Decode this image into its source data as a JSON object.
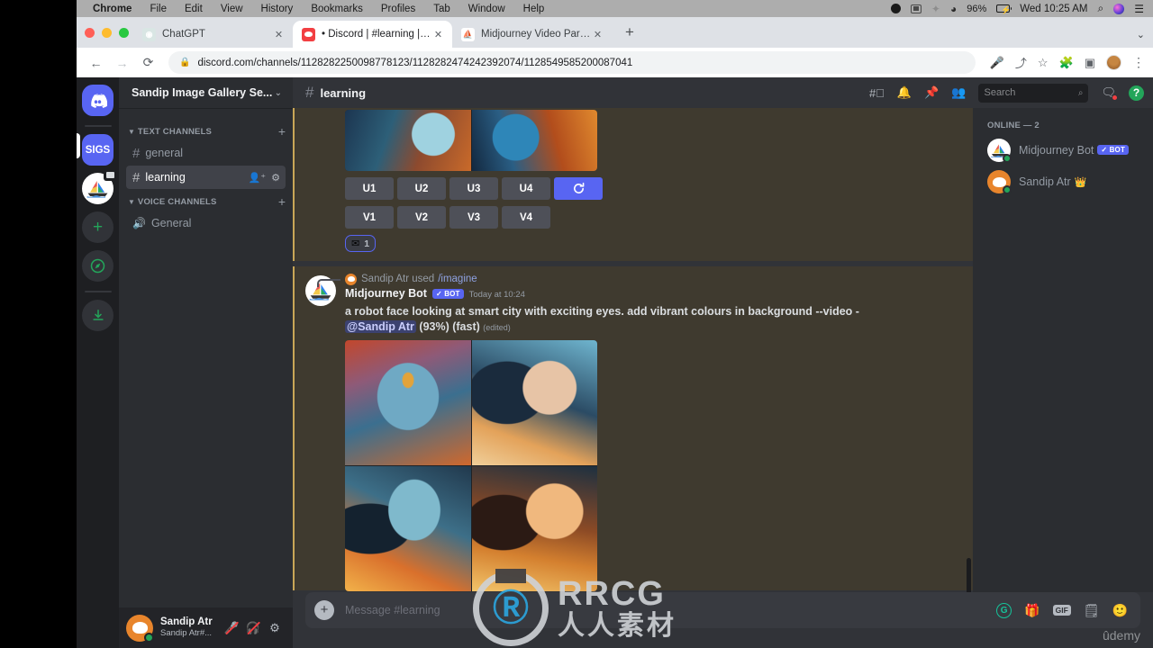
{
  "os_menubar": {
    "items": [
      "Chrome",
      "File",
      "Edit",
      "View",
      "History",
      "Bookmarks",
      "Profiles",
      "Tab",
      "Window",
      "Help"
    ],
    "battery": "96%",
    "clock": "Wed 10:25 AM",
    "icons": [
      "record-icon",
      "screen-mirroring-icon",
      "bluetooth-icon",
      "wifi-icon",
      "battery-icon",
      "spotlight-search-icon",
      "siri-icon",
      "control-center-icon"
    ]
  },
  "browser": {
    "tabs": [
      {
        "title": "ChatGPT",
        "favicon": "chatgpt-favicon",
        "active": false
      },
      {
        "title": "• Discord | #learning | Sandip I",
        "favicon": "discord-favicon",
        "active": true
      },
      {
        "title": "Midjourney Video Parameter",
        "favicon": "midjourney-favicon",
        "active": false
      }
    ],
    "new_tab_label": "+",
    "url": "discord.com/channels/1128282250098778123/1128282474242392074/1128549585200087041",
    "nav": {
      "back": "←",
      "forward": "→",
      "reload": "⟳"
    },
    "toolbar_icons": [
      "microphone-icon",
      "share-icon",
      "bookmark-star-icon",
      "extensions-icon",
      "side-panel-icon",
      "profile-avatar",
      "chrome-menu-icon"
    ]
  },
  "discord": {
    "servers": [
      {
        "name": "home-button",
        "label": ""
      },
      {
        "name": "server-sigs",
        "label": "SIGS",
        "active": true
      },
      {
        "name": "server-midjourney",
        "label": ""
      },
      {
        "name": "add-server-button",
        "label": "+"
      },
      {
        "name": "explore-servers-button",
        "label": "◈"
      },
      {
        "name": "download-apps-button",
        "label": "⤓"
      }
    ],
    "guild_name": "Sandip Image Gallery Se...",
    "categories": [
      {
        "name": "Text Channels",
        "channels": [
          {
            "name": "general",
            "active": false
          },
          {
            "name": "learning",
            "active": true
          }
        ]
      },
      {
        "name": "Voice Channels",
        "channels": [
          {
            "name": "General",
            "active": false
          }
        ]
      }
    ],
    "user_panel": {
      "name": "Sandip Atr",
      "tag": "Sandip Atr#...",
      "icons": [
        "mic-muted-icon",
        "headphones-deafened-icon",
        "user-settings-gear-icon"
      ]
    },
    "channel_header": {
      "hash": "#",
      "title": "learning",
      "icons": [
        "threads-icon",
        "notifications-bell-icon",
        "pinned-messages-icon",
        "member-list-icon"
      ],
      "search_placeholder": "Search",
      "inbox": "inbox-icon",
      "help": "?"
    },
    "members": {
      "title": "Online — 2",
      "list": [
        {
          "name": "Midjourney Bot",
          "badge": "BOT",
          "crown": "",
          "avatar": "midjourney-sailboat-avatar"
        },
        {
          "name": "Sandip Atr",
          "badge": "",
          "crown": "👑",
          "avatar": "discord-orange-avatar"
        }
      ]
    },
    "messages": [
      {
        "id": "msg-top",
        "buttons_row1": [
          "U1",
          "U2",
          "U3",
          "U4"
        ],
        "refresh_button": "🔄",
        "buttons_row2": [
          "V1",
          "V2",
          "V3",
          "V4"
        ],
        "reaction": {
          "emoji": "✉",
          "count": "1"
        }
      },
      {
        "id": "msg-bottom",
        "reply_line": "Sandip Atr used",
        "reply_command": "/imagine",
        "author": "Midjourney Bot",
        "bot_tag": "BOT",
        "timestamp": "Today at 10:24",
        "prompt": "a robot face looking at smart city with exciting eyes. add vibrant colours in background --video -",
        "mention": "@Sandip Atr",
        "progress": "(93%) (fast)",
        "edited": "(edited)"
      }
    ],
    "composer": {
      "placeholder": "Message #learning",
      "icons": [
        "grammarly-icon",
        "gift-icon",
        "gif-icon",
        "sticker-icon",
        "emoji-icon"
      ],
      "gif_label": "GIF"
    }
  },
  "watermarks": {
    "rrcg": "RRCG",
    "rrcg_cn": "人人素材",
    "udemy": "ûdemy"
  },
  "colors": {
    "discord_blurple": "#5865f2",
    "discord_dark": "#313338",
    "sidebar": "#2b2d31",
    "rail": "#1e1f22",
    "mention_bg": "#3f3a2f",
    "mention_bar": "#c8a657",
    "online_green": "#23a55a",
    "red": "#f23f42"
  }
}
